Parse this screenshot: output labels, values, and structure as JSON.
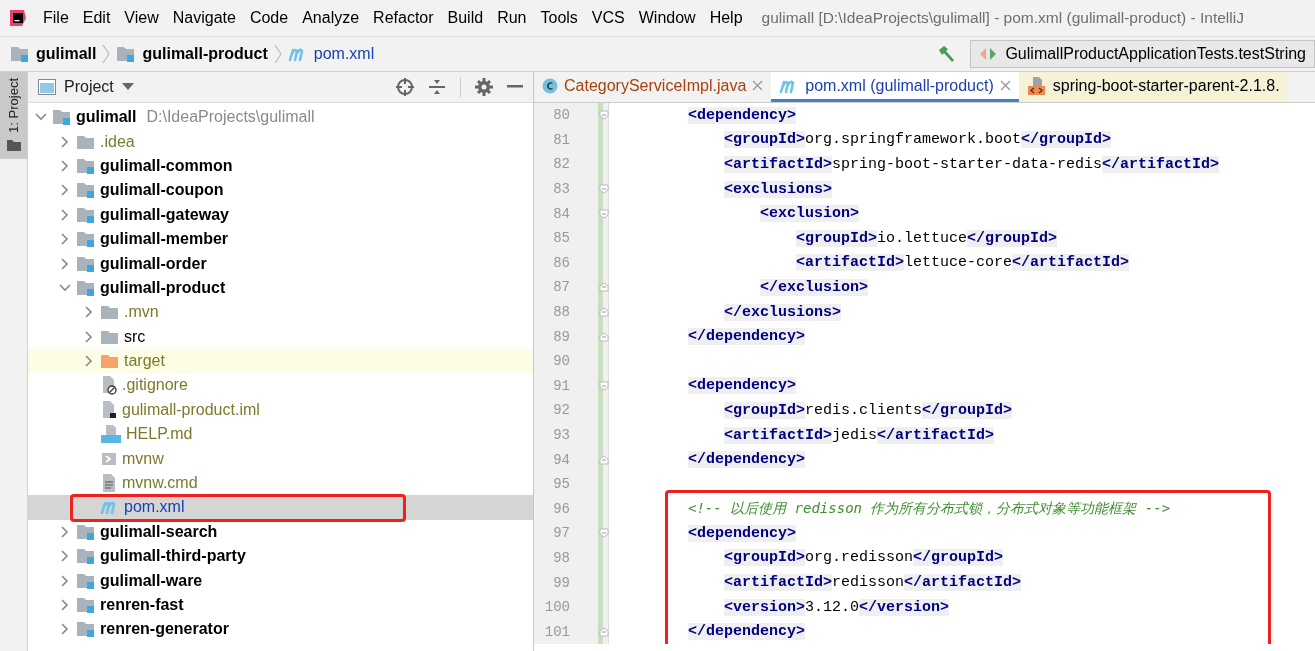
{
  "menu_bar": {
    "items": [
      "File",
      "Edit",
      "View",
      "Navigate",
      "Code",
      "Analyze",
      "Refactor",
      "Build",
      "Run",
      "Tools",
      "VCS",
      "Window",
      "Help"
    ],
    "title": "gulimall [D:\\IdeaProjects\\gulimall] - pom.xml (gulimall-product) - IntelliJ"
  },
  "breadcrumbs": [
    {
      "label": "gulimall",
      "kind": "module"
    },
    {
      "label": "gulimall-product",
      "kind": "module"
    },
    {
      "label": "pom.xml",
      "kind": "maven"
    }
  ],
  "run_config": {
    "label": "GulimallProductApplicationTests.testString"
  },
  "tool_stripe": {
    "label": "1: Project",
    "selected": true
  },
  "project_panel": {
    "title": "Project",
    "tree": [
      {
        "label": "gulimall",
        "detail": "D:\\IdeaProjects\\gulimall",
        "kind": "module",
        "ignored": false,
        "modified": false,
        "expanded": true,
        "selected": false,
        "highlighted": false,
        "boxed": false,
        "children": [
          {
            "label": ".idea",
            "kind": "folder",
            "ignored": true,
            "modified": false,
            "expanded": false,
            "selected": false,
            "highlighted": false,
            "boxed": false
          },
          {
            "label": "gulimall-common",
            "kind": "module",
            "ignored": false,
            "modified": false,
            "expanded": false,
            "selected": false,
            "highlighted": false,
            "boxed": false
          },
          {
            "label": "gulimall-coupon",
            "kind": "module",
            "ignored": false,
            "modified": false,
            "expanded": false,
            "selected": false,
            "highlighted": false,
            "boxed": false
          },
          {
            "label": "gulimall-gateway",
            "kind": "module",
            "ignored": false,
            "modified": false,
            "expanded": false,
            "selected": false,
            "highlighted": false,
            "boxed": false
          },
          {
            "label": "gulimall-member",
            "kind": "module",
            "ignored": false,
            "modified": false,
            "expanded": false,
            "selected": false,
            "highlighted": false,
            "boxed": false
          },
          {
            "label": "gulimall-order",
            "kind": "module",
            "ignored": false,
            "modified": false,
            "expanded": false,
            "selected": false,
            "highlighted": false,
            "boxed": false
          },
          {
            "label": "gulimall-product",
            "kind": "module",
            "ignored": false,
            "modified": false,
            "expanded": true,
            "selected": false,
            "highlighted": false,
            "boxed": false,
            "children": [
              {
                "label": ".mvn",
                "kind": "folder",
                "ignored": true,
                "modified": false,
                "expanded": false,
                "selected": false,
                "highlighted": false,
                "boxed": false
              },
              {
                "label": "src",
                "kind": "folder",
                "ignored": false,
                "modified": false,
                "expanded": false,
                "selected": false,
                "highlighted": false,
                "boxed": false
              },
              {
                "label": "target",
                "kind": "excluded",
                "ignored": true,
                "modified": false,
                "expanded": false,
                "selected": false,
                "highlighted": true,
                "boxed": false
              },
              {
                "label": ".gitignore",
                "kind": "ignore-file",
                "ignored": true,
                "modified": false,
                "selected": false,
                "highlighted": false,
                "boxed": false
              },
              {
                "label": "gulimall-product.iml",
                "kind": "iml-file",
                "ignored": true,
                "modified": false,
                "selected": false,
                "highlighted": false,
                "boxed": false
              },
              {
                "label": "HELP.md",
                "kind": "md-file",
                "ignored": true,
                "modified": false,
                "selected": false,
                "highlighted": false,
                "boxed": false
              },
              {
                "label": "mvnw",
                "kind": "script-file",
                "ignored": true,
                "modified": false,
                "selected": false,
                "highlighted": false,
                "boxed": false
              },
              {
                "label": "mvnw.cmd",
                "kind": "text-file",
                "ignored": true,
                "modified": false,
                "selected": false,
                "highlighted": false,
                "boxed": false
              },
              {
                "label": "pom.xml",
                "kind": "maven",
                "ignored": false,
                "modified": true,
                "selected": true,
                "highlighted": false,
                "boxed": true
              }
            ]
          },
          {
            "label": "gulimall-search",
            "kind": "module",
            "ignored": false,
            "modified": false,
            "expanded": false,
            "selected": false,
            "highlighted": false,
            "boxed": false
          },
          {
            "label": "gulimall-third-party",
            "kind": "module",
            "ignored": false,
            "modified": false,
            "expanded": false,
            "selected": false,
            "highlighted": false,
            "boxed": false
          },
          {
            "label": "gulimall-ware",
            "kind": "module",
            "ignored": false,
            "modified": false,
            "expanded": false,
            "selected": false,
            "highlighted": false,
            "boxed": false
          },
          {
            "label": "renren-fast",
            "kind": "module",
            "ignored": false,
            "modified": false,
            "expanded": false,
            "selected": false,
            "highlighted": false,
            "boxed": false
          },
          {
            "label": "renren-generator",
            "kind": "module",
            "ignored": false,
            "modified": false,
            "expanded": false,
            "selected": false,
            "highlighted": false,
            "boxed": false
          }
        ]
      }
    ]
  },
  "editor_tabs": [
    {
      "label": "CategoryServiceImpl.java",
      "kind": "class",
      "selected": false,
      "closable": true
    },
    {
      "label": "pom.xml (gulimall-product)",
      "kind": "maven",
      "selected": true,
      "closable": true
    },
    {
      "label": "spring-boot-starter-parent-2.1.8.",
      "kind": "library",
      "selected": false,
      "closable": false
    }
  ],
  "editor": {
    "lines": [
      {
        "number": "80",
        "kind": "fold-start",
        "tokens": [
          {
            "kind": "tag",
            "text": "<dependency>"
          }
        ],
        "children": [
          {
            "number": "81",
            "tokens": [
              {
                "kind": "tag",
                "text": "<groupId>"
              },
              {
                "kind": "text",
                "text": "org.springframework.boot"
              },
              {
                "kind": "tag",
                "text": "</groupId>"
              }
            ]
          },
          {
            "number": "82",
            "tokens": [
              {
                "kind": "tag",
                "text": "<artifactId>"
              },
              {
                "kind": "text",
                "text": "spring-boot-starter-data-redis"
              },
              {
                "kind": "tag",
                "text": "</artifactId>"
              }
            ]
          },
          {
            "number": "83",
            "kind": "fold-start",
            "tokens": [
              {
                "kind": "tag",
                "text": "<exclusions>"
              }
            ],
            "children": [
              {
                "number": "84",
                "kind": "fold-start",
                "tokens": [
                  {
                    "kind": "tag",
                    "text": "<exclusion>"
                  }
                ],
                "children": [
                  {
                    "number": "85",
                    "tokens": [
                      {
                        "kind": "tag",
                        "text": "<groupId>"
                      },
                      {
                        "kind": "text",
                        "text": "io.lettuce"
                      },
                      {
                        "kind": "tag",
                        "text": "</groupId>"
                      }
                    ]
                  },
                  {
                    "number": "86",
                    "tokens": [
                      {
                        "kind": "tag",
                        "text": "<artifactId>"
                      },
                      {
                        "kind": "text",
                        "text": "lettuce-core"
                      },
                      {
                        "kind": "tag",
                        "text": "</artifactId>"
                      }
                    ]
                  }
                ]
              },
              {
                "number": "87",
                "kind": "fold-end",
                "tokens": [
                  {
                    "kind": "tag",
                    "text": "</exclusion>"
                  }
                ]
              }
            ]
          },
          {
            "number": "88",
            "kind": "fold-end",
            "tokens": [
              {
                "kind": "tag",
                "text": "</exclusions>"
              }
            ]
          }
        ]
      },
      {
        "number": "89",
        "kind": "fold-end",
        "tokens": [
          {
            "kind": "tag",
            "text": "</dependency>"
          }
        ]
      },
      {
        "number": "90"
      },
      {
        "number": "91",
        "kind": "fold-start",
        "tokens": [
          {
            "kind": "tag",
            "text": "<dependency>"
          }
        ],
        "children": [
          {
            "number": "92",
            "tokens": [
              {
                "kind": "tag",
                "text": "<groupId>"
              },
              {
                "kind": "text",
                "text": "redis.clients"
              },
              {
                "kind": "tag",
                "text": "</groupId>"
              }
            ]
          },
          {
            "number": "93",
            "tokens": [
              {
                "kind": "tag",
                "text": "<artifactId>"
              },
              {
                "kind": "text",
                "text": "jedis"
              },
              {
                "kind": "tag",
                "text": "</artifactId>"
              }
            ]
          }
        ]
      },
      {
        "number": "94",
        "kind": "fold-end",
        "tokens": [
          {
            "kind": "tag",
            "text": "</dependency>"
          }
        ]
      },
      {
        "number": "95"
      },
      {
        "kind": "highlight-box",
        "children": [
          {
            "number": "96",
            "tokens": [
              {
                "kind": "comment",
                "text": "<!-- 以后使用 redisson 作为所有分布式锁，分布式对象等功能框架 -->"
              }
            ]
          },
          {
            "number": "97",
            "kind": "fold-start",
            "tokens": [
              {
                "kind": "tag",
                "text": "<dependency>"
              }
            ],
            "children": [
              {
                "number": "98",
                "tokens": [
                  {
                    "kind": "tag",
                    "text": "<groupId>"
                  },
                  {
                    "kind": "text",
                    "text": "org.redisson"
                  },
                  {
                    "kind": "tag",
                    "text": "</groupId>"
                  }
                ]
              },
              {
                "number": "99",
                "tokens": [
                  {
                    "kind": "tag",
                    "text": "<artifactId>"
                  },
                  {
                    "kind": "text",
                    "text": "redisson"
                  },
                  {
                    "kind": "tag",
                    "text": "</artifactId>"
                  }
                ]
              },
              {
                "number": "100",
                "tokens": [
                  {
                    "kind": "tag",
                    "text": "<version>"
                  },
                  {
                    "kind": "text",
                    "text": "3.12.0"
                  },
                  {
                    "kind": "tag",
                    "text": "</version>"
                  }
                ]
              }
            ]
          },
          {
            "number": "101",
            "kind": "fold-end",
            "tokens": [
              {
                "kind": "tag",
                "text": "</dependency>"
              }
            ]
          }
        ]
      }
    ]
  }
}
